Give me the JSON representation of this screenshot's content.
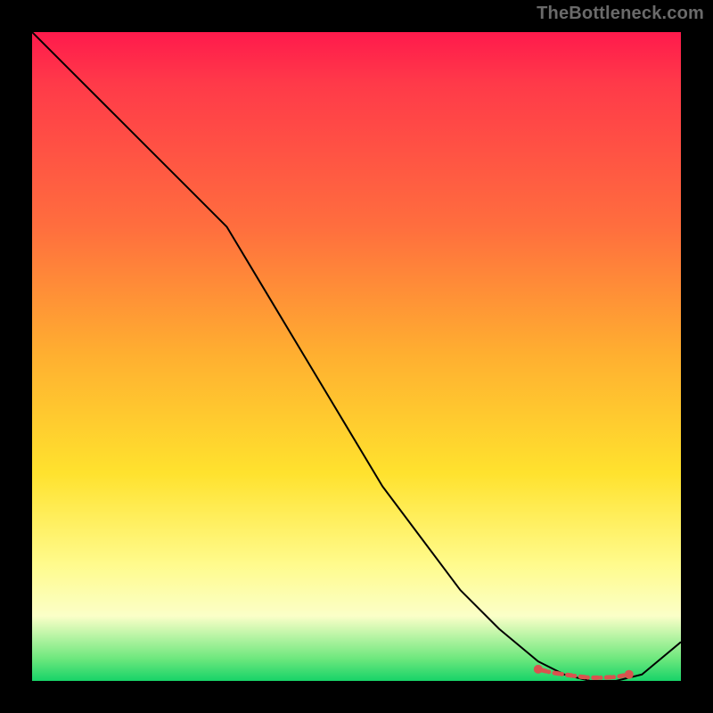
{
  "attribution": "TheBottleneck.com",
  "chart_data": {
    "type": "line",
    "title": "",
    "xlabel": "",
    "ylabel": "",
    "xlim": [
      0,
      100
    ],
    "ylim": [
      0,
      100
    ],
    "grid": false,
    "series": [
      {
        "name": "curve",
        "color": "#000000",
        "stroke_width": 2,
        "x": [
          0,
          6,
          12,
          18,
          24,
          30,
          36,
          42,
          48,
          54,
          60,
          66,
          72,
          78,
          82,
          86,
          90,
          94,
          100
        ],
        "y": [
          100,
          94,
          88,
          82,
          76,
          70,
          60,
          50,
          40,
          30,
          22,
          14,
          8,
          3,
          1,
          0,
          0,
          1,
          6
        ]
      },
      {
        "name": "marker-band",
        "color": "#d9534f",
        "marker_style": "dash-dots",
        "x": [
          78,
          80,
          82,
          84,
          86,
          88,
          90,
          92
        ],
        "y": [
          1.8,
          1.3,
          1.0,
          0.7,
          0.5,
          0.5,
          0.6,
          1.0
        ]
      }
    ],
    "gradient_stops": [
      {
        "pos": 0,
        "color": "#ff1a4c"
      },
      {
        "pos": 0.08,
        "color": "#ff3a49"
      },
      {
        "pos": 0.3,
        "color": "#ff6e3e"
      },
      {
        "pos": 0.5,
        "color": "#ffb030"
      },
      {
        "pos": 0.68,
        "color": "#ffe22e"
      },
      {
        "pos": 0.82,
        "color": "#fffb8c"
      },
      {
        "pos": 0.9,
        "color": "#fbffc8"
      },
      {
        "pos": 0.965,
        "color": "#6fe87e"
      },
      {
        "pos": 1.0,
        "color": "#17d368"
      }
    ]
  }
}
